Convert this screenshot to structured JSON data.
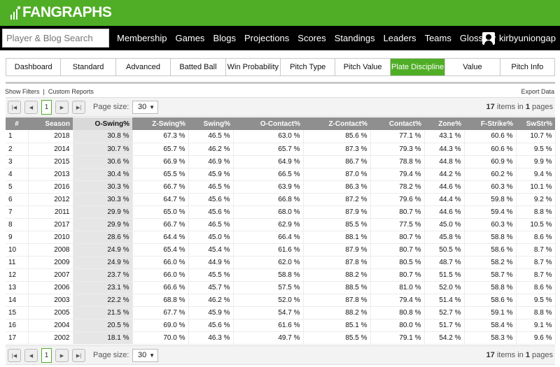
{
  "brand": {
    "logo_text": "FANGRAPHS"
  },
  "nav": {
    "search_placeholder": "Player & Blog Search",
    "links": [
      "Membership",
      "Games",
      "Blogs",
      "Projections",
      "Scores",
      "Standings",
      "Leaders",
      "Teams",
      "Glossary"
    ],
    "username": "kirbyuniongap"
  },
  "tabs": [
    "Dashboard",
    "Standard",
    "Advanced",
    "Batted Ball",
    "Win Probability",
    "Pitch Type",
    "Pitch Value",
    "Plate Discipline",
    "Value",
    "Pitch Info"
  ],
  "active_tab": "Plate Discipline",
  "toolbar": {
    "show_filters": "Show Filters",
    "separator": "|",
    "custom_reports": "Custom Reports",
    "export": "Export Data"
  },
  "pager": {
    "first": "|◀",
    "prev": "◀",
    "next": "▶",
    "last": "▶|",
    "current_page": "1",
    "page_size_label": "Page size:",
    "page_size": "30",
    "items_count": "17",
    "items_text": "items in",
    "pages_count": "1",
    "pages_text": "pages"
  },
  "table": {
    "columns": [
      "#",
      "Season",
      "O-Swing%",
      "Z-Swing%",
      "Swing%",
      "O-Contact%",
      "Z-Contact%",
      "Contact%",
      "Zone%",
      "F-Strike%",
      "SwStr%"
    ],
    "sorted_column": "O-Swing%",
    "rows": [
      [
        "1",
        "2018",
        "30.8 %",
        "67.3 %",
        "46.5 %",
        "63.0 %",
        "85.6 %",
        "77.1 %",
        "43.1 %",
        "60.6 %",
        "10.7 %"
      ],
      [
        "2",
        "2014",
        "30.7 %",
        "65.7 %",
        "46.2 %",
        "65.7 %",
        "87.3 %",
        "79.3 %",
        "44.3 %",
        "60.6 %",
        "9.5 %"
      ],
      [
        "3",
        "2015",
        "30.6 %",
        "66.9 %",
        "46.9 %",
        "64.9 %",
        "86.7 %",
        "78.8 %",
        "44.8 %",
        "60.9 %",
        "9.9 %"
      ],
      [
        "4",
        "2013",
        "30.4 %",
        "65.5 %",
        "45.9 %",
        "66.5 %",
        "87.0 %",
        "79.4 %",
        "44.2 %",
        "60.2 %",
        "9.4 %"
      ],
      [
        "5",
        "2016",
        "30.3 %",
        "66.7 %",
        "46.5 %",
        "63.9 %",
        "86.3 %",
        "78.2 %",
        "44.6 %",
        "60.3 %",
        "10.1 %"
      ],
      [
        "6",
        "2012",
        "30.3 %",
        "64.7 %",
        "45.6 %",
        "66.8 %",
        "87.2 %",
        "79.6 %",
        "44.4 %",
        "59.8 %",
        "9.2 %"
      ],
      [
        "7",
        "2011",
        "29.9 %",
        "65.0 %",
        "45.6 %",
        "68.0 %",
        "87.9 %",
        "80.7 %",
        "44.6 %",
        "59.4 %",
        "8.8 %"
      ],
      [
        "8",
        "2017",
        "29.9 %",
        "66.7 %",
        "46.5 %",
        "62.9 %",
        "85.5 %",
        "77.5 %",
        "45.0 %",
        "60.3 %",
        "10.5 %"
      ],
      [
        "9",
        "2010",
        "28.6 %",
        "64.4 %",
        "45.0 %",
        "66.4 %",
        "88.1 %",
        "80.7 %",
        "45.8 %",
        "58.8 %",
        "8.6 %"
      ],
      [
        "10",
        "2008",
        "24.9 %",
        "65.4 %",
        "45.4 %",
        "61.6 %",
        "87.9 %",
        "80.7 %",
        "50.5 %",
        "58.6 %",
        "8.7 %"
      ],
      [
        "11",
        "2009",
        "24.9 %",
        "66.0 %",
        "44.9 %",
        "62.0 %",
        "87.8 %",
        "80.5 %",
        "48.7 %",
        "58.2 %",
        "8.7 %"
      ],
      [
        "12",
        "2007",
        "23.7 %",
        "66.0 %",
        "45.5 %",
        "58.8 %",
        "88.2 %",
        "80.7 %",
        "51.5 %",
        "58.7 %",
        "8.7 %"
      ],
      [
        "13",
        "2006",
        "23.1 %",
        "66.6 %",
        "45.7 %",
        "57.5 %",
        "88.5 %",
        "81.0 %",
        "52.0 %",
        "58.8 %",
        "8.6 %"
      ],
      [
        "14",
        "2003",
        "22.2 %",
        "68.8 %",
        "46.2 %",
        "52.0 %",
        "87.8 %",
        "79.4 %",
        "51.4 %",
        "58.6 %",
        "9.5 %"
      ],
      [
        "15",
        "2005",
        "21.5 %",
        "67.7 %",
        "45.9 %",
        "54.7 %",
        "88.2 %",
        "80.8 %",
        "52.7 %",
        "59.1 %",
        "8.8 %"
      ],
      [
        "16",
        "2004",
        "20.5 %",
        "69.0 %",
        "45.6 %",
        "61.6 %",
        "85.1 %",
        "80.0 %",
        "51.7 %",
        "58.4 %",
        "9.1 %"
      ],
      [
        "17",
        "2002",
        "18.1 %",
        "70.0 %",
        "46.3 %",
        "49.7 %",
        "85.5 %",
        "79.1 %",
        "54.2 %",
        "58.3 %",
        "9.6 %"
      ]
    ]
  },
  "colors": {
    "brand_green": "#50ae26",
    "nav_black": "#000000",
    "header_gray": "#8f8f8f",
    "sorted_header": "#d9d9d9",
    "sorted_cell": "#e6e6e6"
  }
}
